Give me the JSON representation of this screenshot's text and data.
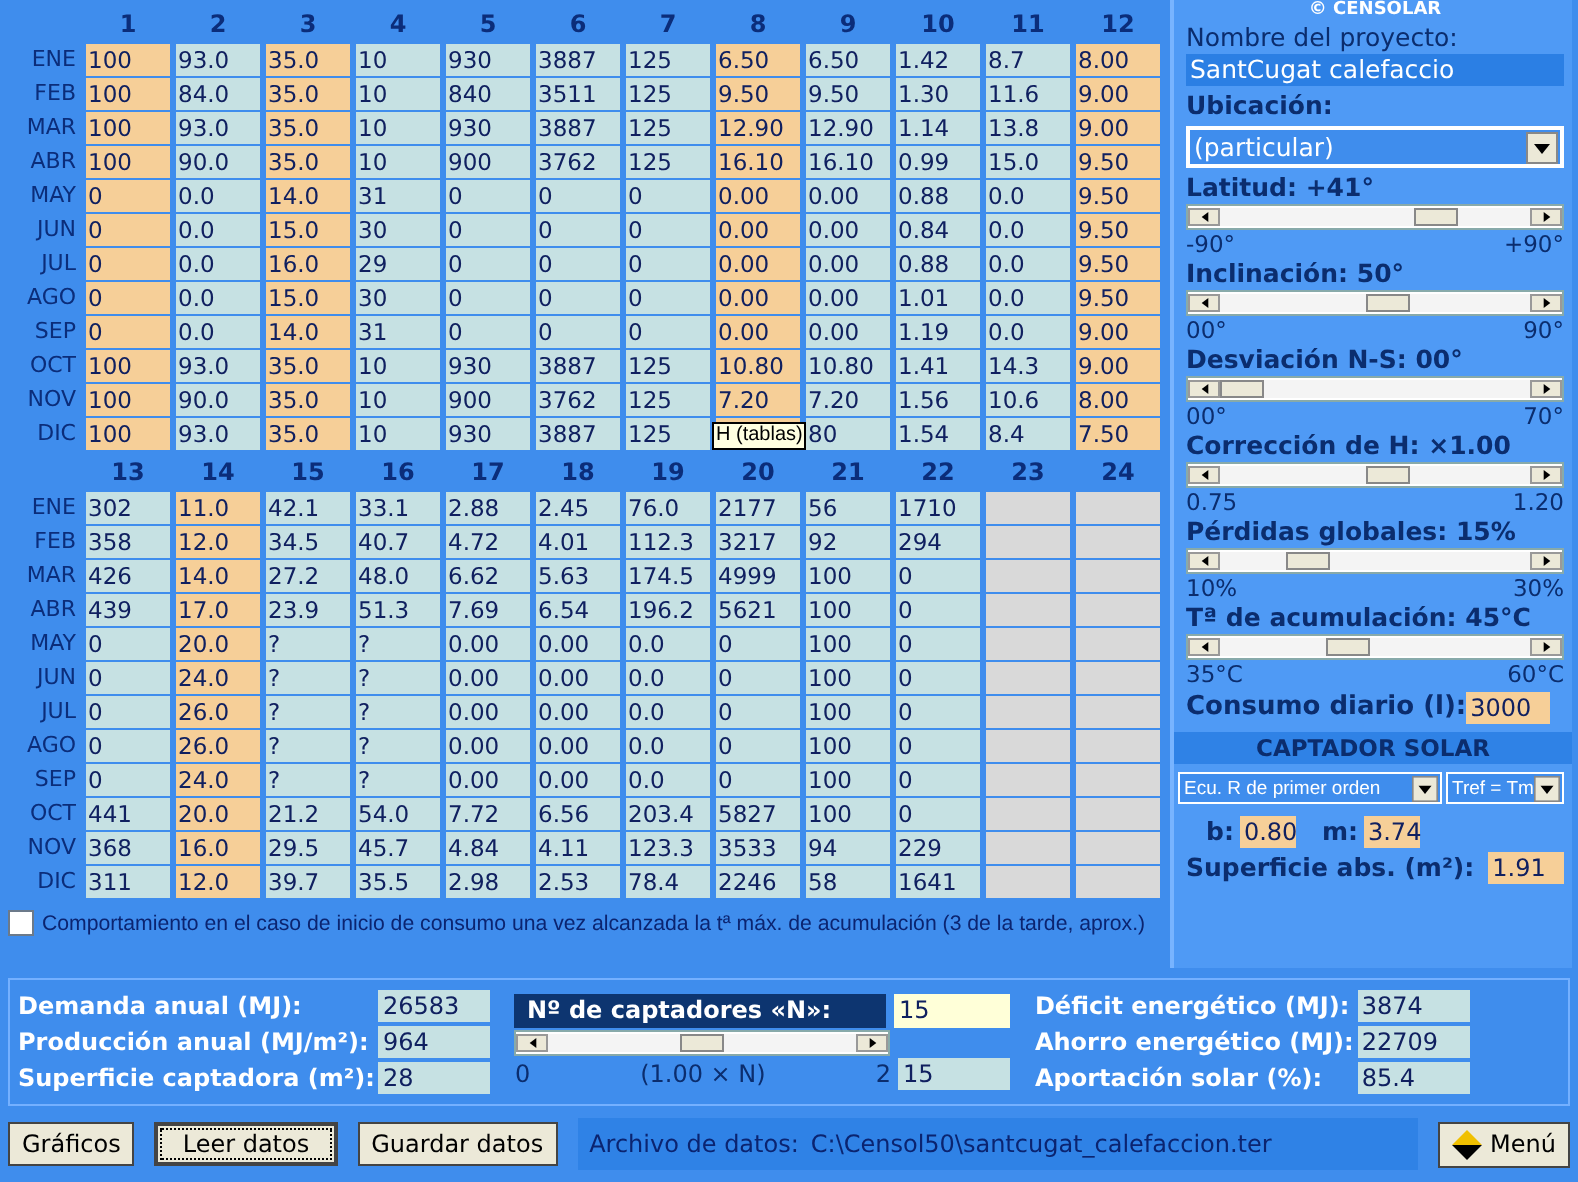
{
  "top_table": {
    "columns": [
      {
        "label": "1",
        "kind": "input"
      },
      {
        "label": "2",
        "kind": "calc"
      },
      {
        "label": "3",
        "kind": "input"
      },
      {
        "label": "4",
        "kind": "calc"
      },
      {
        "label": "5",
        "kind": "calc"
      },
      {
        "label": "6",
        "kind": "calc"
      },
      {
        "label": "7",
        "kind": "calc"
      },
      {
        "label": "8",
        "kind": "input"
      },
      {
        "label": "9",
        "kind": "calc"
      },
      {
        "label": "10",
        "kind": "calc"
      },
      {
        "label": "11",
        "kind": "calc"
      },
      {
        "label": "12",
        "kind": "input"
      }
    ],
    "rows": [
      {
        "month": "ENE",
        "values": [
          "100",
          "93.0",
          "35.0",
          "10",
          "930",
          "3887",
          "125",
          "6.50",
          "6.50",
          "1.42",
          "8.7",
          "8.00"
        ]
      },
      {
        "month": "FEB",
        "values": [
          "100",
          "84.0",
          "35.0",
          "10",
          "840",
          "3511",
          "125",
          "9.50",
          "9.50",
          "1.30",
          "11.6",
          "9.00"
        ]
      },
      {
        "month": "MAR",
        "values": [
          "100",
          "93.0",
          "35.0",
          "10",
          "930",
          "3887",
          "125",
          "12.90",
          "12.90",
          "1.14",
          "13.8",
          "9.00"
        ]
      },
      {
        "month": "ABR",
        "values": [
          "100",
          "90.0",
          "35.0",
          "10",
          "900",
          "3762",
          "125",
          "16.10",
          "16.10",
          "0.99",
          "15.0",
          "9.50"
        ]
      },
      {
        "month": "MAY",
        "values": [
          "0",
          "0.0",
          "14.0",
          "31",
          "0",
          "0",
          "0",
          "0.00",
          "0.00",
          "0.88",
          "0.0",
          "9.50"
        ]
      },
      {
        "month": "JUN",
        "values": [
          "0",
          "0.0",
          "15.0",
          "30",
          "0",
          "0",
          "0",
          "0.00",
          "0.00",
          "0.84",
          "0.0",
          "9.50"
        ]
      },
      {
        "month": "JUL",
        "values": [
          "0",
          "0.0",
          "16.0",
          "29",
          "0",
          "0",
          "0",
          "0.00",
          "0.00",
          "0.88",
          "0.0",
          "9.50"
        ]
      },
      {
        "month": "AGO",
        "values": [
          "0",
          "0.0",
          "15.0",
          "30",
          "0",
          "0",
          "0",
          "0.00",
          "0.00",
          "1.01",
          "0.0",
          "9.50"
        ]
      },
      {
        "month": "SEP",
        "values": [
          "0",
          "0.0",
          "14.0",
          "31",
          "0",
          "0",
          "0",
          "0.00",
          "0.00",
          "1.19",
          "0.0",
          "9.00"
        ]
      },
      {
        "month": "OCT",
        "values": [
          "100",
          "93.0",
          "35.0",
          "10",
          "930",
          "3887",
          "125",
          "10.80",
          "10.80",
          "1.41",
          "14.3",
          "9.00"
        ]
      },
      {
        "month": "NOV",
        "values": [
          "100",
          "90.0",
          "35.0",
          "10",
          "900",
          "3762",
          "125",
          "7.20",
          "7.20",
          "1.56",
          "10.6",
          "8.00"
        ]
      },
      {
        "month": "DIC",
        "values": [
          "100",
          "93.0",
          "35.0",
          "10",
          "930",
          "3887",
          "125",
          {
            "tooltip": "H (tablas)"
          },
          "80",
          "1.54",
          "8.4",
          "7.50"
        ]
      }
    ]
  },
  "bottom_table": {
    "columns": [
      {
        "label": "13",
        "kind": "calc"
      },
      {
        "label": "14",
        "kind": "input"
      },
      {
        "label": "15",
        "kind": "calc"
      },
      {
        "label": "16",
        "kind": "calc"
      },
      {
        "label": "17",
        "kind": "calc"
      },
      {
        "label": "18",
        "kind": "calc"
      },
      {
        "label": "19",
        "kind": "calc"
      },
      {
        "label": "20",
        "kind": "calc"
      },
      {
        "label": "21",
        "kind": "calc"
      },
      {
        "label": "22",
        "kind": "calc"
      },
      {
        "label": "23",
        "kind": "empty"
      },
      {
        "label": "24",
        "kind": "empty"
      }
    ],
    "rows": [
      {
        "month": "ENE",
        "values": [
          "302",
          "11.0",
          "42.1",
          "33.1",
          "2.88",
          "2.45",
          "76.0",
          "2177",
          "56",
          "1710"
        ]
      },
      {
        "month": "FEB",
        "values": [
          "358",
          "12.0",
          "34.5",
          "40.7",
          "4.72",
          "4.01",
          "112.3",
          "3217",
          "92",
          "294"
        ]
      },
      {
        "month": "MAR",
        "values": [
          "426",
          "14.0",
          "27.2",
          "48.0",
          "6.62",
          "5.63",
          "174.5",
          "4999",
          "100",
          "0"
        ]
      },
      {
        "month": "ABR",
        "values": [
          "439",
          "17.0",
          "23.9",
          "51.3",
          "7.69",
          "6.54",
          "196.2",
          "5621",
          "100",
          "0"
        ]
      },
      {
        "month": "MAY",
        "values": [
          "0",
          "20.0",
          "?",
          "?",
          "0.00",
          "0.00",
          "0.0",
          "0",
          "100",
          "0"
        ]
      },
      {
        "month": "JUN",
        "values": [
          "0",
          "24.0",
          "?",
          "?",
          "0.00",
          "0.00",
          "0.0",
          "0",
          "100",
          "0"
        ]
      },
      {
        "month": "JUL",
        "values": [
          "0",
          "26.0",
          "?",
          "?",
          "0.00",
          "0.00",
          "0.0",
          "0",
          "100",
          "0"
        ]
      },
      {
        "month": "AGO",
        "values": [
          "0",
          "26.0",
          "?",
          "?",
          "0.00",
          "0.00",
          "0.0",
          "0",
          "100",
          "0"
        ]
      },
      {
        "month": "SEP",
        "values": [
          "0",
          "24.0",
          "?",
          "?",
          "0.00",
          "0.00",
          "0.0",
          "0",
          "100",
          "0"
        ]
      },
      {
        "month": "OCT",
        "values": [
          "441",
          "20.0",
          "21.2",
          "54.0",
          "7.72",
          "6.56",
          "203.4",
          "5827",
          "100",
          "0"
        ]
      },
      {
        "month": "NOV",
        "values": [
          "368",
          "16.0",
          "29.5",
          "45.7",
          "4.84",
          "4.11",
          "123.3",
          "3533",
          "94",
          "229"
        ]
      },
      {
        "month": "DIC",
        "values": [
          "311",
          "12.0",
          "39.7",
          "35.5",
          "2.98",
          "2.53",
          "78.4",
          "2246",
          "58",
          "1641"
        ]
      }
    ]
  },
  "option": {
    "label": "Comportamiento en el caso de inicio de consumo una vez alcanzada la tª máx. de acumulación (3 de la tarde, aprox.)",
    "checked": false
  },
  "side_panel": {
    "brand": "© CENSOLAR",
    "project_label": "Nombre del proyecto:",
    "project_name": "SantCugat calefaccio",
    "location_label": "Ubicación:",
    "location": "(particular)",
    "sliders": [
      {
        "label": "Latitud: +41°",
        "level": 0.73,
        "min": "-90°",
        "max": "+90°"
      },
      {
        "label": "Inclinación: 50°",
        "level": 0.55,
        "min": "00°",
        "max": "90°"
      },
      {
        "label": "Desviación N-S: 00°",
        "level": 0.0,
        "min": "00°",
        "max": "70°"
      },
      {
        "label": "Corrección de H: ×1.00",
        "level": 0.55,
        "min": "0.75",
        "max": "1.20"
      },
      {
        "label": "Pérdidas globales: 15%",
        "level": 0.25,
        "min": "10%",
        "max": "30%"
      },
      {
        "label": "Tª de acumulación: 45°C",
        "level": 0.4,
        "min": "35°C",
        "max": "60°C"
      }
    ],
    "consumption_label": "Consumo diario (l):",
    "consumption": "3000",
    "collector_title": "CAPTADOR SOLAR",
    "equation": "Ecu. R de primer orden",
    "tref": "Tref = Tm",
    "b_label": "b:",
    "b": "0.80",
    "m_label": "m:",
    "m": "3.74",
    "area_label": "Superficie abs. (m²):",
    "area": "1.91"
  },
  "summary": {
    "left": [
      {
        "label": "Demanda anual (MJ):",
        "value": "26583"
      },
      {
        "label": "Producción anual (MJ/m²):",
        "value": "964"
      },
      {
        "label": "Superficie captadora (m²):",
        "value": "28"
      }
    ],
    "collectors": {
      "label": "Nº de captadores «N»:",
      "value": "15",
      "level": 0.5,
      "min": "0",
      "factor": "(1.00 × N)",
      "max": "2",
      "result": "15"
    },
    "right": [
      {
        "label": "Déficit energético (MJ):",
        "value": "3874"
      },
      {
        "label": "Ahorro energético (MJ):",
        "value": "22709"
      },
      {
        "label": "Aportación solar (%):",
        "value": "85.4"
      }
    ]
  },
  "buttons": [
    {
      "label": "Gráficos",
      "focused": false
    },
    {
      "label": "Leer datos",
      "focused": true
    },
    {
      "label": "Guardar datos",
      "focused": false
    }
  ],
  "file": {
    "label": "Archivo de datos:",
    "path": "C:\\Censol50\\santcugat_calefaccion.ter"
  },
  "menu_button": "Menú"
}
